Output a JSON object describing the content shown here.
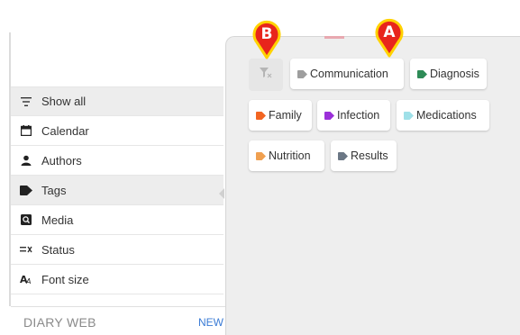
{
  "sidebar": {
    "items": [
      {
        "label": "Show all",
        "icon": "filter-lines-icon",
        "active": true
      },
      {
        "label": "Calendar",
        "icon": "calendar-icon",
        "active": false
      },
      {
        "label": "Authors",
        "icon": "person-icon",
        "active": false
      },
      {
        "label": "Tags",
        "icon": "tag-icon",
        "active": true
      },
      {
        "label": "Media",
        "icon": "media-icon",
        "active": false
      },
      {
        "label": "Status",
        "icon": "status-icon",
        "active": false
      },
      {
        "label": "Font size",
        "icon": "font-size-icon",
        "active": false
      }
    ]
  },
  "footer": {
    "title": "DIARY WEB",
    "new_label": "NEW"
  },
  "tags": [
    {
      "label": "Communication",
      "color": "#9e9e9e"
    },
    {
      "label": "Diagnosis",
      "color": "#2e8b57"
    },
    {
      "label": "Family",
      "color": "#f26522"
    },
    {
      "label": "Infection",
      "color": "#9b30d9"
    },
    {
      "label": "Medications",
      "color": "#9fe0e8"
    },
    {
      "label": "Nutrition",
      "color": "#f0a050"
    },
    {
      "label": "Results",
      "color": "#6b7785"
    }
  ],
  "callouts": [
    {
      "letter": "A",
      "color": "#e8251c"
    },
    {
      "letter": "B",
      "color": "#e8251c"
    }
  ],
  "colors": {
    "callout_fill": "#e8251c",
    "callout_stroke": "#ffd200",
    "panel_bg": "#eeeeee"
  }
}
